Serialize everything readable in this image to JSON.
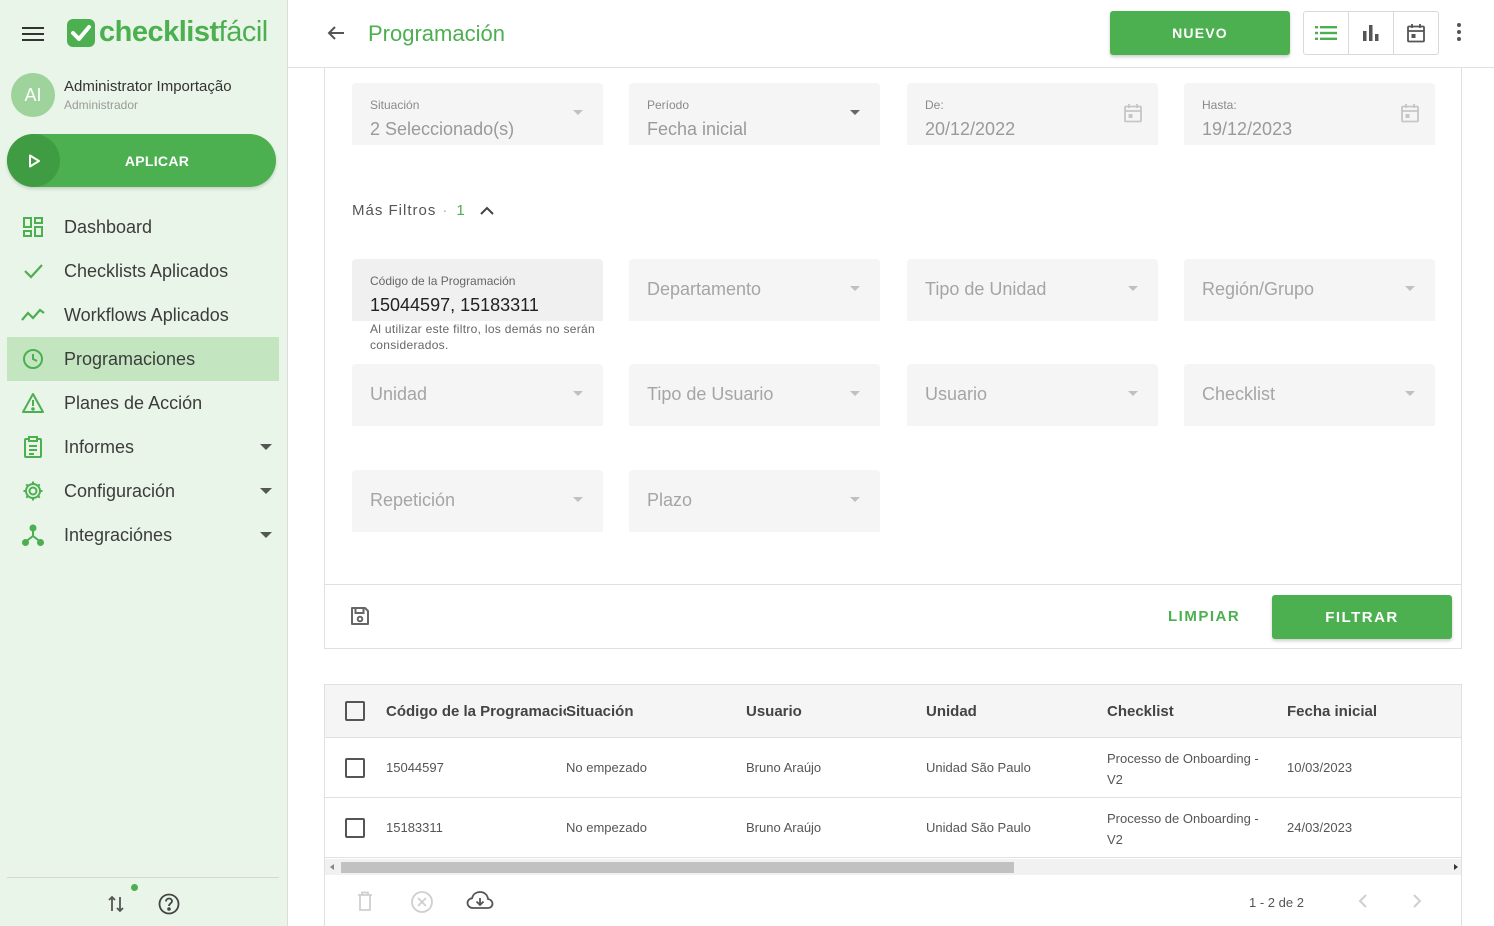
{
  "app": {
    "logo_text_bold": "checklist",
    "logo_text_light": "fácil",
    "brand_color": "#4caf50"
  },
  "user": {
    "initials": "AI",
    "name": "Administrator Importação",
    "role": "Administrador"
  },
  "sidebar": {
    "apply_label": "APLICAR",
    "items": [
      {
        "label": "Dashboard",
        "icon": "dashboard-icon"
      },
      {
        "label": "Checklists Aplicados",
        "icon": "check-icon"
      },
      {
        "label": "Workflows Aplicados",
        "icon": "trend-icon"
      },
      {
        "label": "Programaciones",
        "icon": "clock-icon",
        "active": true
      },
      {
        "label": "Planes de Acción",
        "icon": "warning-icon"
      },
      {
        "label": "Informes",
        "icon": "clipboard-icon",
        "expandable": true
      },
      {
        "label": "Configuración",
        "icon": "gear-icon",
        "expandable": true
      },
      {
        "label": "Integraciónes",
        "icon": "integration-icon",
        "expandable": true
      }
    ]
  },
  "header": {
    "title": "Programación",
    "new_button": "NUEVO"
  },
  "filters": {
    "situacion": {
      "label": "Situación",
      "value": "2 Seleccionado(s)"
    },
    "periodo": {
      "label": "Período",
      "value": "Fecha inicial"
    },
    "de": {
      "label": "De:",
      "value": "20/12/2022"
    },
    "hasta": {
      "label": "Hasta:",
      "value": "19/12/2023"
    },
    "more_label": "Más Filtros",
    "more_count": "1",
    "codigo": {
      "label": "Código de la Programación",
      "value": "15044597, 15183311"
    },
    "codigo_hint": "Al utilizar este filtro, los demás no serán considerados.",
    "departamento": "Departamento",
    "tipo_unidad": "Tipo de Unidad",
    "region": "Región/Grupo",
    "unidad": "Unidad",
    "tipo_usuario": "Tipo de Usuario",
    "usuario": "Usuario",
    "checklist": "Checklist",
    "repeticion": "Repetición",
    "plazo": "Plazo",
    "clear_label": "LIMPIAR",
    "filter_label": "FILTRAR"
  },
  "table": {
    "columns": [
      "Código de la Programación",
      "Situación",
      "Usuario",
      "Unidad",
      "Checklist",
      "Fecha inicial"
    ],
    "rows": [
      {
        "codigo": "15044597",
        "situacion": "No empezado",
        "usuario": "Bruno Araújo",
        "unidad": "Unidad São Paulo",
        "checklist": "Processo de Onboarding - V2",
        "fecha": "10/03/2023"
      },
      {
        "codigo": "15183311",
        "situacion": "No empezado",
        "usuario": "Bruno Araújo",
        "unidad": "Unidad São Paulo",
        "checklist": "Processo de Onboarding - V2",
        "fecha": "24/03/2023"
      }
    ],
    "pagination": "1 - 2 de 2"
  }
}
